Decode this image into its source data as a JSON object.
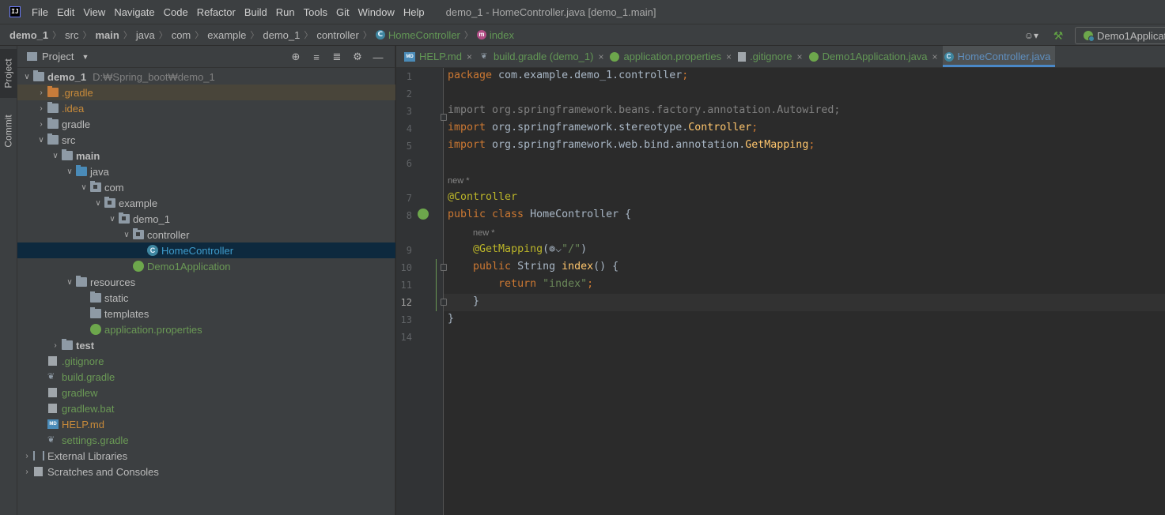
{
  "menubar": {
    "logo": "IJ",
    "items": [
      "File",
      "Edit",
      "View",
      "Navigate",
      "Code",
      "Refactor",
      "Build",
      "Run",
      "Tools",
      "Git",
      "Window",
      "Help"
    ],
    "window_title": "demo_1 - HomeController.java [demo_1.main]"
  },
  "breadcrumb": [
    "demo_1",
    "src",
    "main",
    "java",
    "com",
    "example",
    "demo_1",
    "controller",
    "HomeController",
    "index"
  ],
  "nav_right": {
    "run_config": "Demo1Applicat",
    "user_glyph": "☺▾",
    "hammer_glyph": "⚒"
  },
  "left_strip": {
    "project_tab": "Project",
    "commit_tab": "Commit"
  },
  "project_panel": {
    "title": "Project",
    "dropdown_glyph": "▼",
    "tools": [
      "⊕",
      "≡",
      "≣",
      "⚙",
      "—"
    ],
    "tree": [
      {
        "label": "demo_1",
        "path": "D:₩Spring_boot₩demo_1",
        "depth": 0,
        "arrow": "open",
        "icon": "folder",
        "style": "bold"
      },
      {
        "label": ".gradle",
        "depth": 1,
        "arrow": "closed",
        "icon": "folder-orange",
        "style": "orange",
        "highlight": true
      },
      {
        "label": ".idea",
        "depth": 1,
        "arrow": "closed",
        "icon": "folder",
        "style": "orange"
      },
      {
        "label": "gradle",
        "depth": 1,
        "arrow": "closed",
        "icon": "folder",
        "style": "normal"
      },
      {
        "label": "src",
        "depth": 1,
        "arrow": "open",
        "icon": "folder",
        "style": "normal"
      },
      {
        "label": "main",
        "depth": 2,
        "arrow": "open",
        "icon": "folder",
        "style": "bold"
      },
      {
        "label": "java",
        "depth": 3,
        "arrow": "open",
        "icon": "folder-blue",
        "style": "normal"
      },
      {
        "label": "com",
        "depth": 4,
        "arrow": "open",
        "icon": "folder-pkg",
        "style": "normal"
      },
      {
        "label": "example",
        "depth": 5,
        "arrow": "open",
        "icon": "folder-pkg",
        "style": "normal"
      },
      {
        "label": "demo_1",
        "depth": 6,
        "arrow": "open",
        "icon": "folder-pkg",
        "style": "normal"
      },
      {
        "label": "controller",
        "depth": 7,
        "arrow": "open",
        "icon": "folder-pkg",
        "style": "normal"
      },
      {
        "label": "HomeController",
        "depth": 8,
        "arrow": "none",
        "icon": "class",
        "style": "blue",
        "selected": true
      },
      {
        "label": "Demo1Application",
        "depth": 7,
        "arrow": "none",
        "icon": "spring",
        "style": "green"
      },
      {
        "label": "resources",
        "depth": 3,
        "arrow": "open",
        "icon": "folder",
        "style": "normal"
      },
      {
        "label": "static",
        "depth": 4,
        "arrow": "none",
        "icon": "folder",
        "style": "normal"
      },
      {
        "label": "templates",
        "depth": 4,
        "arrow": "none",
        "icon": "folder",
        "style": "normal"
      },
      {
        "label": "application.properties",
        "depth": 4,
        "arrow": "none",
        "icon": "spring",
        "style": "green"
      },
      {
        "label": "test",
        "depth": 2,
        "arrow": "closed",
        "icon": "folder",
        "style": "bold"
      },
      {
        "label": ".gitignore",
        "depth": 1,
        "arrow": "none",
        "icon": "file",
        "style": "green"
      },
      {
        "label": "build.gradle",
        "depth": 1,
        "arrow": "none",
        "icon": "gradle",
        "style": "green"
      },
      {
        "label": "gradlew",
        "depth": 1,
        "arrow": "none",
        "icon": "file",
        "style": "green"
      },
      {
        "label": "gradlew.bat",
        "depth": 1,
        "arrow": "none",
        "icon": "file",
        "style": "green"
      },
      {
        "label": "HELP.md",
        "depth": 1,
        "arrow": "none",
        "icon": "md",
        "style": "orange"
      },
      {
        "label": "settings.gradle",
        "depth": 1,
        "arrow": "none",
        "icon": "gradle",
        "style": "green"
      },
      {
        "label": "External Libraries",
        "depth": 0,
        "arrow": "closed",
        "icon": "libs",
        "style": "normal"
      },
      {
        "label": "Scratches and Consoles",
        "depth": 0,
        "arrow": "closed",
        "icon": "scratch",
        "style": "normal"
      }
    ]
  },
  "editor": {
    "tabs": [
      {
        "label": "HELP.md",
        "icon": "md",
        "active": false
      },
      {
        "label": "build.gradle (demo_1)",
        "icon": "gradle",
        "active": false
      },
      {
        "label": "application.properties",
        "icon": "spring",
        "active": false
      },
      {
        "label": ".gitignore",
        "icon": "file",
        "active": false
      },
      {
        "label": "Demo1Application.java",
        "icon": "spring",
        "active": false
      },
      {
        "label": "HomeController.java",
        "icon": "cls",
        "active": true
      }
    ],
    "close_glyph": "×",
    "hints": {
      "class_hint": "new *",
      "method_hint": "new *"
    },
    "lines": [
      {
        "n": "1",
        "parts": [
          [
            "kw",
            "package "
          ],
          [
            "",
            "com.example.demo_1.controller"
          ],
          [
            "kw",
            ";"
          ]
        ]
      },
      {
        "n": "2",
        "parts": []
      },
      {
        "n": "3",
        "parts": [
          [
            "unused",
            "import org.springframework.beans.factory.annotation.Autowired;"
          ]
        ]
      },
      {
        "n": "4",
        "parts": [
          [
            "kw",
            "import "
          ],
          [
            "",
            "org.springframework.stereotype."
          ],
          [
            "fn",
            "Controller"
          ],
          [
            "kw",
            ";"
          ]
        ]
      },
      {
        "n": "5",
        "parts": [
          [
            "kw",
            "import "
          ],
          [
            "",
            "org.springframework.web.bind.annotation."
          ],
          [
            "fn",
            "GetMapping"
          ],
          [
            "kw",
            ";"
          ]
        ]
      },
      {
        "n": "6",
        "parts": []
      },
      {
        "n": "7",
        "parts": [
          [
            "ann",
            "@Controller"
          ]
        ]
      },
      {
        "n": "8",
        "parts": [
          [
            "kw",
            "public class "
          ],
          [
            "",
            "HomeController {"
          ]
        ]
      },
      {
        "n": "9",
        "parts": [
          [
            "",
            "    "
          ],
          [
            "ann",
            "@GetMapping"
          ],
          [
            "",
            "(⊚⌵"
          ],
          [
            "str",
            "\"/\""
          ],
          [
            "",
            ")"
          ]
        ]
      },
      {
        "n": "10",
        "parts": [
          [
            "",
            "    "
          ],
          [
            "kw",
            "public "
          ],
          [
            "",
            "String "
          ],
          [
            "fn",
            "index"
          ],
          [
            "",
            "() {"
          ]
        ]
      },
      {
        "n": "11",
        "parts": [
          [
            "",
            "        "
          ],
          [
            "kw",
            "return "
          ],
          [
            "str",
            "\"index\""
          ],
          [
            "kw",
            ";"
          ]
        ]
      },
      {
        "n": "12",
        "parts": [
          [
            "",
            "    }"
          ]
        ]
      },
      {
        "n": "13",
        "parts": [
          [
            "",
            "}"
          ]
        ]
      },
      {
        "n": "14",
        "parts": []
      }
    ]
  }
}
